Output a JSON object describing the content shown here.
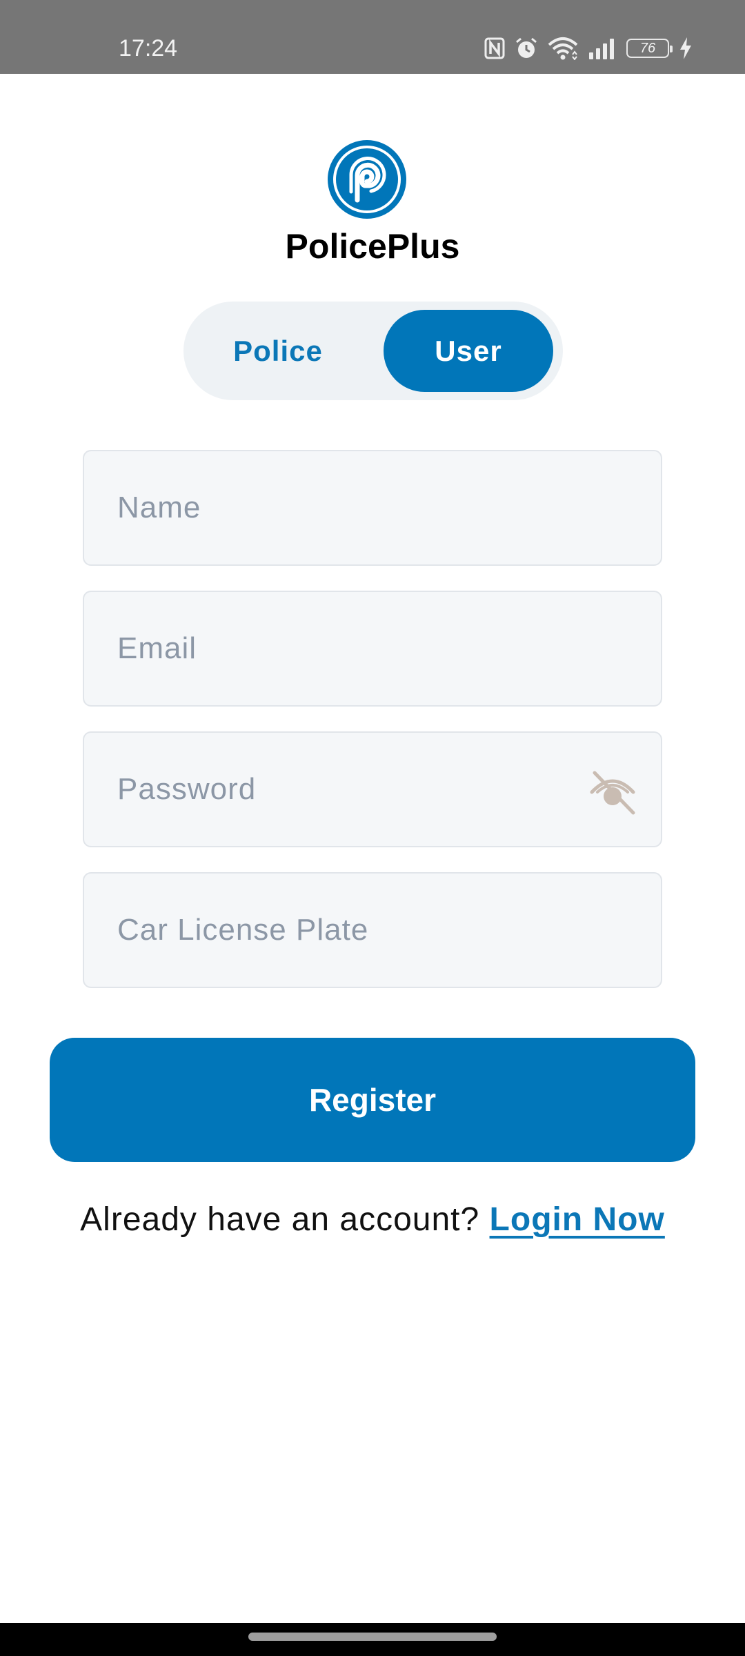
{
  "status_bar": {
    "time": "17:24",
    "battery_level": "76",
    "icons": [
      "nfc-icon",
      "alarm-icon",
      "wifi-icon",
      "signal-icon",
      "battery-icon",
      "charging-icon"
    ]
  },
  "app": {
    "name": "PolicePlus",
    "logo_icon": "policeplus-logo-icon"
  },
  "role_toggle": {
    "options": [
      {
        "label": "Police",
        "selected": false
      },
      {
        "label": "User",
        "selected": true
      }
    ]
  },
  "form": {
    "name": {
      "placeholder": "Name",
      "value": ""
    },
    "email": {
      "placeholder": "Email",
      "value": ""
    },
    "password": {
      "placeholder": "Password",
      "value": "",
      "toggle_icon": "eye-off-icon"
    },
    "plate": {
      "placeholder": "Car License Plate",
      "value": ""
    }
  },
  "register_label": "Register",
  "login_prompt": {
    "text": "Already have an account?",
    "link_label": "Login Now"
  },
  "colors": {
    "primary": "#0176b9",
    "status_bar_bg": "#767676",
    "field_bg": "#f5f7f9",
    "placeholder": "#8c97a6",
    "toggle_bg": "#eef2f5",
    "eye_icon": "#c9bcb2"
  }
}
